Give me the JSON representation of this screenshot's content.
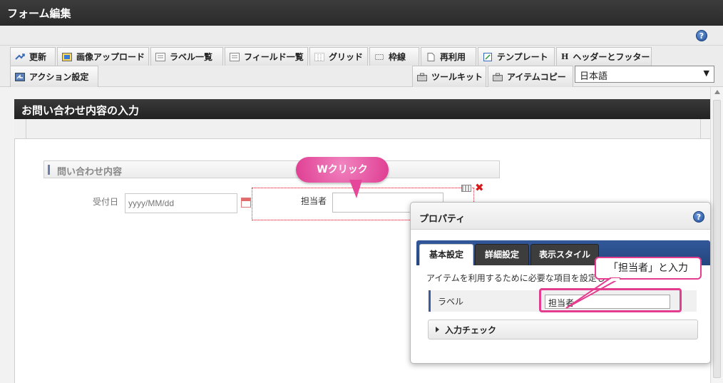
{
  "window": {
    "title": "フォーム編集",
    "help_glyph": "?"
  },
  "toolbar": {
    "row1": [
      {
        "label": "更新",
        "icon": "refresh-icon"
      },
      {
        "label": "画像アップロード",
        "icon": "image-upload-icon"
      },
      {
        "label": "ラベル一覧",
        "icon": "list-icon"
      },
      {
        "label": "フィールド一覧",
        "icon": "field-list-icon"
      },
      {
        "label": "グリッド",
        "icon": "grid-icon"
      },
      {
        "label": "枠線",
        "icon": "border-icon"
      },
      {
        "label": "再利用",
        "icon": "reuse-icon"
      },
      {
        "label": "テンプレート",
        "icon": "template-icon"
      },
      {
        "label": "ヘッダーとフッター",
        "icon": "header-icon",
        "glyph": "H"
      }
    ],
    "row2_left": [
      {
        "label": "アクション設定",
        "icon": "action-icon"
      }
    ],
    "row2_right": [
      {
        "label": "ツールキット",
        "icon": "toolkit-icon"
      },
      {
        "label": "アイテムコピー",
        "icon": "copy-icon"
      }
    ],
    "language": {
      "value": "日本語"
    }
  },
  "form": {
    "title": "お問い合わせ内容の入力",
    "section": "問い合わせ内容",
    "fields": {
      "date": {
        "label": "受付日",
        "placeholder": "yyyy/MM/dd"
      },
      "person": {
        "label": "担当者",
        "value": ""
      }
    }
  },
  "annotations": {
    "double_click": "Wクリック",
    "enter_hint": "「担当者」と入力"
  },
  "properties": {
    "title": "プロパティ",
    "tabs": [
      {
        "label": "基本設定",
        "active": true
      },
      {
        "label": "詳細設定",
        "active": false
      },
      {
        "label": "表示スタイル",
        "active": false
      }
    ],
    "description": "アイテムを利用するために必要な項目を設定し",
    "label_key": "ラベル",
    "label_value": "担当者",
    "accordion": "入力チェック"
  },
  "colors": {
    "accent_pink": "#e43c8f",
    "tab_blue": "#2d5190",
    "dark_header": "#2a2a2a"
  }
}
